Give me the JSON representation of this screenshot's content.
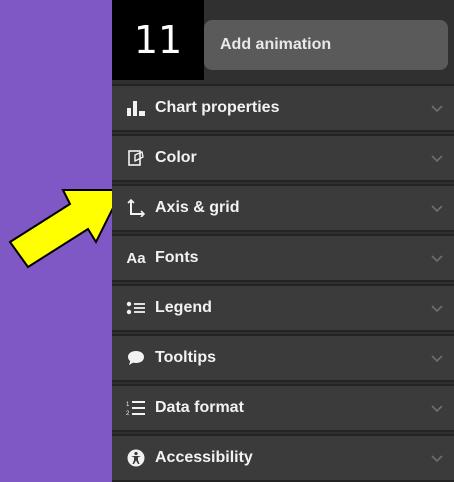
{
  "step_badge": "11",
  "add_animation_label": "Add animation",
  "sections": [
    {
      "label": "Chart properties",
      "icon": "bar-chart-icon"
    },
    {
      "label": "Color",
      "icon": "palette-icon"
    },
    {
      "label": "Axis & grid",
      "icon": "axis-icon"
    },
    {
      "label": "Fonts",
      "icon": "fonts-icon",
      "icon_text": "Aa"
    },
    {
      "label": "Legend",
      "icon": "legend-icon"
    },
    {
      "label": "Tooltips",
      "icon": "tooltip-icon"
    },
    {
      "label": "Data format",
      "icon": "numbered-list-icon"
    },
    {
      "label": "Accessibility",
      "icon": "accessibility-icon"
    }
  ],
  "colors": {
    "background": "#7f58c6",
    "panel": "#303030",
    "section": "#3b3b3b",
    "arrow": "#ffff00"
  }
}
